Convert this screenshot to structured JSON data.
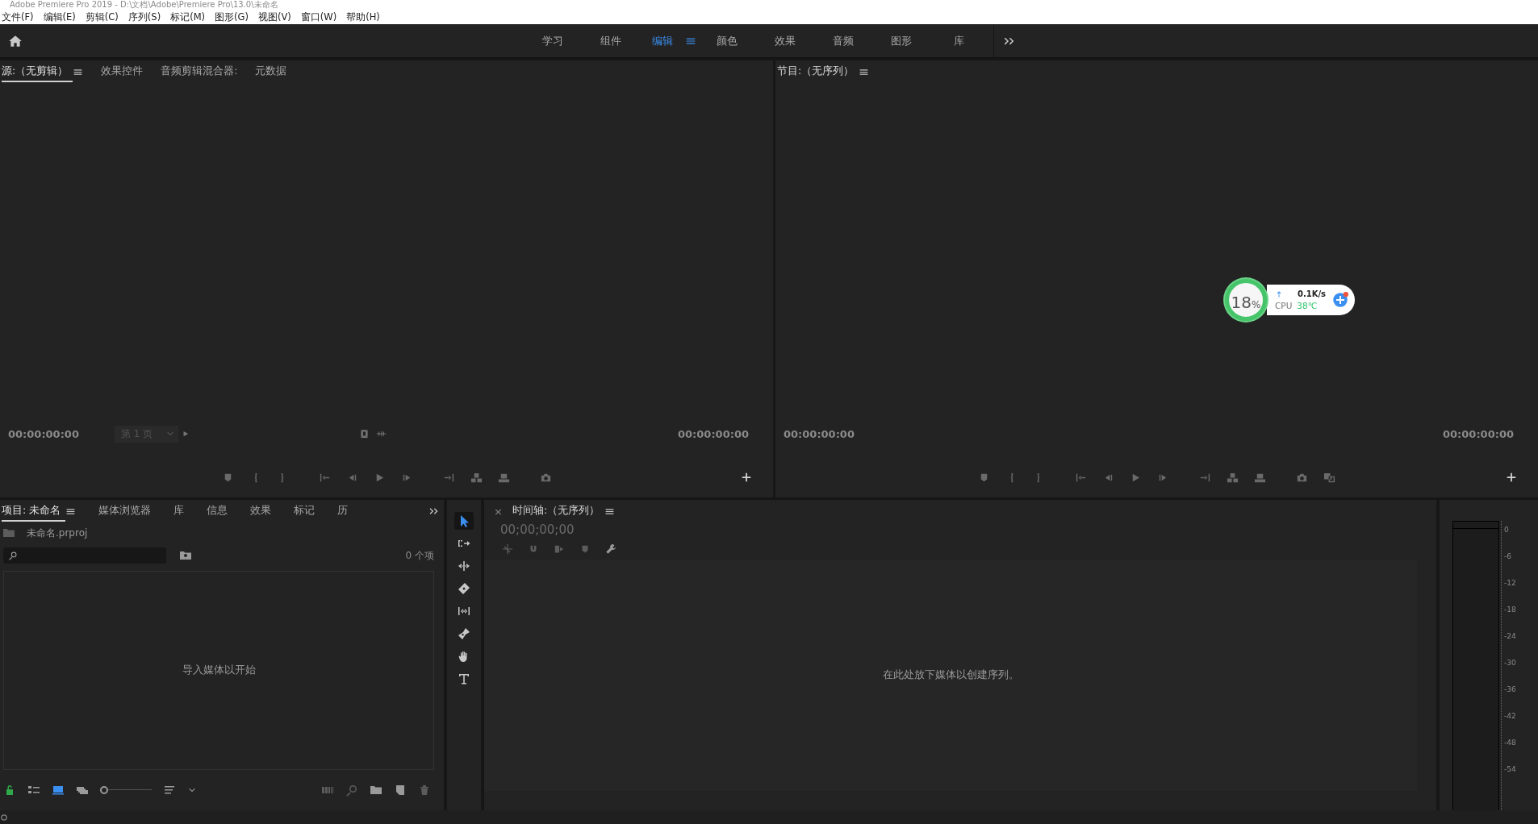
{
  "window": {
    "title": "Adobe Premiere Pro 2019 - D:\\文档\\Adobe\\Premiere Pro\\13.0\\未命名"
  },
  "menu": [
    "文件(F)",
    "编辑(E)",
    "剪辑(C)",
    "序列(S)",
    "标记(M)",
    "图形(G)",
    "视图(V)",
    "窗口(W)",
    "帮助(H)"
  ],
  "workspaces": [
    {
      "label": "学习",
      "selected": false
    },
    {
      "label": "组件",
      "selected": false
    },
    {
      "label": "编辑",
      "selected": true
    },
    {
      "label": "颜色",
      "selected": false
    },
    {
      "label": "效果",
      "selected": false
    },
    {
      "label": "音频",
      "selected": false
    },
    {
      "label": "图形",
      "selected": false
    },
    {
      "label": "库",
      "selected": false
    }
  ],
  "source_panel": {
    "tabs": [
      {
        "label": "源:（无剪辑）",
        "selected": true
      },
      {
        "label": "效果控件",
        "selected": false
      },
      {
        "label": "音频剪辑混合器:",
        "selected": false
      },
      {
        "label": "元数据",
        "selected": false
      }
    ],
    "timecode_left": "00:00:00:00",
    "page_select": "第 1 页",
    "timecode_right": "00:00:00:00"
  },
  "program_panel": {
    "title": "节目:（无序列）",
    "timecode_left": "00:00:00:00",
    "timecode_right": "00:00:00:00"
  },
  "cpu_widget": {
    "usage": "18",
    "unit": "%",
    "net": "0.1K/s",
    "cpu_label": "CPU",
    "temp": "38℃"
  },
  "project_panel": {
    "tabs": [
      {
        "label": "项目: 未命名",
        "selected": true
      },
      {
        "label": "媒体浏览器",
        "selected": false
      },
      {
        "label": "库",
        "selected": false
      },
      {
        "label": "信息",
        "selected": false
      },
      {
        "label": "效果",
        "selected": false
      },
      {
        "label": "标记",
        "selected": false
      },
      {
        "label": "历",
        "selected": false
      }
    ],
    "file": "未命名.prproj",
    "count": "0 个项",
    "empty_text": "导入媒体以开始",
    "zoom_slider": {
      "level": 0
    }
  },
  "tools": [
    {
      "kind": "select",
      "selected": true
    },
    {
      "kind": "track",
      "selected": false
    },
    {
      "kind": "ripple",
      "selected": false
    },
    {
      "kind": "razor",
      "selected": false
    },
    {
      "kind": "slip",
      "selected": false
    },
    {
      "kind": "pen",
      "selected": false
    },
    {
      "kind": "hand",
      "selected": false
    },
    {
      "kind": "type",
      "selected": false
    }
  ],
  "timeline": {
    "close": "×",
    "title": "时间轴:（无序列）",
    "timecode": "00;00;00;00",
    "empty_text": "在此处放下媒体以创建序列。"
  },
  "meter": {
    "scale": [
      "0",
      "-6",
      "-12",
      "-18",
      "-24",
      "-30",
      "-36",
      "-42",
      "-48",
      "-54"
    ]
  }
}
